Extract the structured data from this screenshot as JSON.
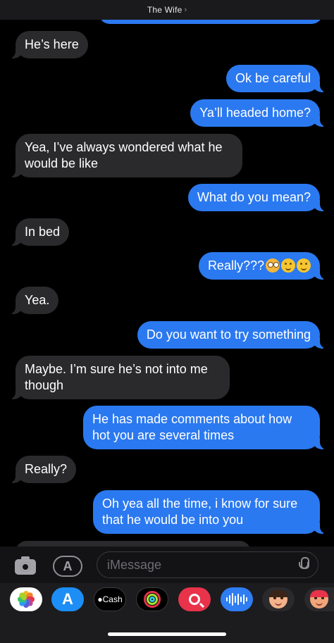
{
  "header": {
    "title": "The Wife",
    "chevron": "›"
  },
  "messages": [
    {
      "dir": "in",
      "text": "He’s here"
    },
    {
      "dir": "out",
      "text": "Ok be careful"
    },
    {
      "dir": "out",
      "text": "Ya’ll headed home?"
    },
    {
      "dir": "in",
      "text": "Yea, I’ve always wondered what he would be like"
    },
    {
      "dir": "out",
      "text": "What do you mean?"
    },
    {
      "dir": "in",
      "text": "In bed"
    },
    {
      "dir": "out",
      "text": "Really???",
      "emojis": [
        "flushed-face",
        "relieved-face",
        "relieved-face"
      ]
    },
    {
      "dir": "in",
      "text": "Yea."
    },
    {
      "dir": "out",
      "text": "Do you want to try something"
    },
    {
      "dir": "in",
      "text": "Maybe. I’m sure he’s not into me though"
    },
    {
      "dir": "out",
      "text": "He has made  comments about how hot you are several times"
    },
    {
      "dir": "in",
      "text": "Really?"
    },
    {
      "dir": "out",
      "text": "Oh yea all the time, i know for sure that he would be into you"
    }
  ],
  "compose": {
    "placeholder": "iMessage",
    "camera_icon": "camera-icon",
    "apps_icon": "app-store-icon",
    "mic_icon": "microphone-icon"
  },
  "app_drawer": {
    "apps": [
      {
        "name": "photos",
        "icon": "photos-icon"
      },
      {
        "name": "app-store",
        "icon": "app-store-icon"
      },
      {
        "name": "cash",
        "label": "Cash",
        "icon": "apple-cash-icon"
      },
      {
        "name": "activity",
        "icon": "activity-rings-icon"
      },
      {
        "name": "search",
        "icon": "search-icon"
      },
      {
        "name": "audio",
        "icon": "audio-message-icon"
      },
      {
        "name": "memoji",
        "icon": "memoji-icon"
      },
      {
        "name": "memoji-stickers",
        "icon": "memoji-stickers-icon"
      }
    ]
  },
  "colors": {
    "outgoing_bubble": "#2b79f0",
    "incoming_bubble": "#2a2a2d",
    "background": "#000000"
  }
}
